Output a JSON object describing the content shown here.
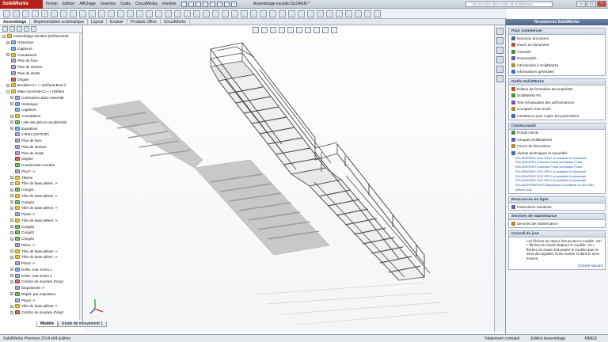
{
  "app": {
    "logo_text": "SolidWorks",
    "document_title": "Assemblage escalier.SLDASM *",
    "search_placeholder": "Rechercher dans l'aide de SolidWorks",
    "accent_color": "#b3201a"
  },
  "menu": [
    "Fichier",
    "Edition",
    "Affichage",
    "Insertion",
    "Outils",
    "CircuitWorks",
    "Fenêtre"
  ],
  "command_tabs": [
    {
      "label": "Assemblage",
      "active": true
    },
    {
      "label": "Représentation schématique",
      "active": false
    },
    {
      "label": "Layout",
      "active": false
    },
    {
      "label": "Evaluer",
      "active": false
    },
    {
      "label": "Produits Office",
      "active": false
    },
    {
      "label": "CircuitWorks",
      "active": false
    }
  ],
  "tree": [
    {
      "label": "Assemblage escalier (Défaut<Etat",
      "icon": "y",
      "toggle": "-"
    },
    {
      "label": "Historique",
      "icon": "b",
      "toggle": "+"
    },
    {
      "label": "Capteurs",
      "icon": "b",
      "toggle": ""
    },
    {
      "label": "Annotations",
      "icon": "y",
      "toggle": "+"
    },
    {
      "label": "Plan de face",
      "icon": "p",
      "toggle": ""
    },
    {
      "label": "Plan de dessus",
      "icon": "p",
      "toggle": ""
    },
    {
      "label": "Plan de droite",
      "icon": "p",
      "toggle": ""
    },
    {
      "label": "Origine",
      "icon": "r",
      "toggle": ""
    },
    {
      "label": "Escalier<1> -> (Défaut<Brut d",
      "icon": "y",
      "toggle": "+"
    },
    {
      "label": "Main-courante<1> -> (Défaut",
      "icon": "y",
      "toggle": "-"
    },
    {
      "label": "Contraintes dans Assembl",
      "icon": "b",
      "toggle": "+"
    },
    {
      "label": "Historique",
      "icon": "b",
      "toggle": "+"
    },
    {
      "label": "Capteurs",
      "icon": "b",
      "toggle": ""
    },
    {
      "label": "Annotations",
      "icon": "y",
      "toggle": "+"
    },
    {
      "label": "Liste des pièces soudées(9)",
      "icon": "g",
      "toggle": "+"
    },
    {
      "label": "Equations",
      "icon": "b",
      "toggle": "+"
    },
    {
      "label": "1.0044 (S275JR)",
      "icon": "p",
      "toggle": ""
    },
    {
      "label": "Plan de face",
      "icon": "p",
      "toggle": ""
    },
    {
      "label": "Plan de dessus",
      "icon": "p",
      "toggle": ""
    },
    {
      "label": "Plan de droite",
      "icon": "p",
      "toggle": ""
    },
    {
      "label": "Origine",
      "icon": "r",
      "toggle": ""
    },
    {
      "label": "Construction soudée",
      "icon": "g",
      "toggle": ""
    },
    {
      "label": "Plan7 ->",
      "icon": "p",
      "toggle": ""
    },
    {
      "label": "Tôlerie",
      "icon": "y",
      "toggle": "+"
    },
    {
      "label": "Tôle de base pliée1 ->",
      "icon": "y",
      "toggle": "+"
    },
    {
      "label": "Congé1",
      "icon": "g",
      "toggle": "+"
    },
    {
      "label": "Tôle de base pliée2 ->",
      "icon": "y",
      "toggle": "+"
    },
    {
      "label": "Congé4",
      "icon": "g",
      "toggle": "+"
    },
    {
      "label": "Tôle de base pliée3 ->",
      "icon": "y",
      "toggle": "+"
    },
    {
      "label": "Plan8 ->",
      "icon": "p",
      "toggle": ""
    },
    {
      "label": "Tôle de base pliée4 ->",
      "icon": "y",
      "toggle": "+"
    },
    {
      "label": "Congé5",
      "icon": "g",
      "toggle": "+"
    },
    {
      "label": "Congé3",
      "icon": "g",
      "toggle": "+"
    },
    {
      "label": "Congé2",
      "icon": "g",
      "toggle": "+"
    },
    {
      "label": "Plan1 ->",
      "icon": "p",
      "toggle": ""
    },
    {
      "label": "Tôle de base pliée6 ->",
      "icon": "y",
      "toggle": "+"
    },
    {
      "label": "Tôle de base pliée7 ->",
      "icon": "y",
      "toggle": "+"
    },
    {
      "label": "Plan2 ->",
      "icon": "p",
      "toggle": ""
    },
    {
      "label": "Enlèv. mat.-Extru.1",
      "icon": "b",
      "toggle": "+"
    },
    {
      "label": "Enlèv. mat.-Extru.2",
      "icon": "b",
      "toggle": "+"
    },
    {
      "label": "Cordon de soudure d'angl",
      "icon": "r",
      "toggle": "+"
    },
    {
      "label": "Esquisse28 ->",
      "icon": "p",
      "toggle": ""
    },
    {
      "label": "Répét. par esquisse1",
      "icon": "g",
      "toggle": "+"
    },
    {
      "label": "Plan3 ->",
      "icon": "p",
      "toggle": ""
    },
    {
      "label": "Tôle de base pliée8 ->",
      "icon": "y",
      "toggle": "+"
    },
    {
      "label": "Cordon de soudure d'angl",
      "icon": "r",
      "toggle": "+"
    }
  ],
  "bottom_tabs": [
    {
      "label": "Modèle",
      "active": true
    },
    {
      "label": "Etude de mouvement 1",
      "active": false
    }
  ],
  "status": {
    "left": "SolidWorks Premium 2014 x64 Edition",
    "state": "Totalement contraint",
    "mode": "Edition Assemblage",
    "units": "MMGS"
  },
  "taskpane": {
    "title": "Ressources SolidWorks",
    "sections": [
      {
        "title": "Pour commencer",
        "items": [
          "Nouveau document",
          "Ouvrir un document",
          "Tutoriels",
          "Nouveautés",
          "Introduction à SolidWorks",
          "Informations générales"
        ]
      },
      {
        "title": "Outils SolidWorks",
        "items": [
          "Editeur de formulaire de propriétés",
          "SolidWorks Rx",
          "Test d'évaluation des performances",
          "Comparer mon score",
          "Assistance pour copier les paramètres"
        ]
      },
      {
        "title": "Communauté",
        "items": [
          "Portail clients",
          "Groupes d'utilisateurs",
          "Forum de discussion",
          "Alertes techniques et nouvelles"
        ],
        "news": [
          "SOLIDWORKS 2013 SP5.1 is available for download",
          "SOLIDWORKS Customer Portal and Admin Portal ...",
          "SOLIDWORKS Customer Portal and Admin Portal ...",
          "SOLIDWORKS 2014 SP5.1 is available for download",
          "SOLIDWORKS 2013 SP5.0 is available for download",
          "SOLIDWORKS 2014 SP4.0 is available for download",
          "SOLIDEXPERIENCE Marketplace is available on 3DS.WE..."
        ],
        "more": "Afficher plus"
      },
      {
        "title": "Ressources en ligne",
        "items": [
          "Partenaires Solutions"
        ]
      },
      {
        "title": "Services de maintenance",
        "items": [
          "Services de maintenance"
        ]
      }
    ],
    "tip": {
      "title": "Conseil du jour",
      "text": "Les flèches du clavier font pivoter le modèle. Ctrl + flèches du clavier déplace le modèle. Alt + flèches du clavier fait pivoter le modèle dans le sens des aiguilles d'une montre et dans le sens inverse.",
      "next": "Conseil suivant"
    }
  }
}
